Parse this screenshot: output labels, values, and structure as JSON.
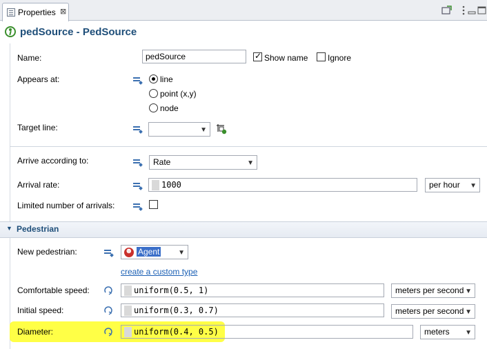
{
  "tab": {
    "label": "Properties",
    "close": "⊠"
  },
  "title": "pedSource - PedSource",
  "fields": {
    "name": {
      "label": "Name:",
      "value": "pedSource",
      "show_name_label": "Show name",
      "show_name_checked": true,
      "ignore_label": "Ignore",
      "ignore_checked": false
    },
    "appears_at": {
      "label": "Appears at:",
      "options": [
        "line",
        "point (x,y)",
        "node"
      ],
      "selected": "line"
    },
    "target_line": {
      "label": "Target line:",
      "value": ""
    },
    "arrive": {
      "label": "Arrive according to:",
      "value": "Rate"
    },
    "arrival_rate": {
      "label": "Arrival rate:",
      "value": "1000",
      "unit": "per hour"
    },
    "limited": {
      "label": "Limited number of arrivals:",
      "checked": false
    }
  },
  "pedestrian": {
    "section_label": "Pedestrian",
    "new_pedestrian": {
      "label": "New pedestrian:",
      "value": "Agent",
      "link": "create a custom type"
    },
    "comfortable_speed": {
      "label": "Comfortable speed:",
      "value": "uniform(0.5, 1)",
      "unit": "meters per second"
    },
    "initial_speed": {
      "label": "Initial speed:",
      "value": "uniform(0.3, 0.7)",
      "unit": "meters per second"
    },
    "diameter": {
      "label": "Diameter:",
      "value": "uniform(0.4, 0.5)",
      "unit": "meters"
    }
  },
  "colors": {
    "highlight": "#ffff3c",
    "title": "#1e4e79",
    "link": "#1a5fb4"
  },
  "icons": [
    "properties-icon",
    "pedestrian-source-icon",
    "new-view-icon",
    "view-menu-icon",
    "minimize-icon",
    "maximize-icon",
    "static-param-icon",
    "dynamic-param-icon",
    "pick-target-icon",
    "agent-icon",
    "chevron-down-icon"
  ]
}
